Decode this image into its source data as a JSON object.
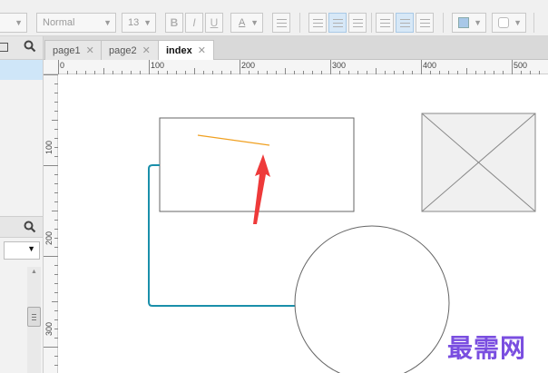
{
  "toolbar": {
    "font_style": "Normal",
    "font_size": "13",
    "bold": "B",
    "italic": "I",
    "underline": "U",
    "font_color": "A"
  },
  "tabs": [
    {
      "label": "page1",
      "close": "✕"
    },
    {
      "label": "page2",
      "close": "✕"
    },
    {
      "label": "index",
      "close": "✕"
    }
  ],
  "ruler": {
    "top": [
      "0",
      "100",
      "200",
      "300",
      "400",
      "500"
    ],
    "left": [
      "100",
      "200",
      "300"
    ]
  },
  "canvas": {
    "line_color": "#f0a020",
    "connector_color": "#1a8faa",
    "arrow_color": "#ee3a3a"
  },
  "watermark": "最需网"
}
